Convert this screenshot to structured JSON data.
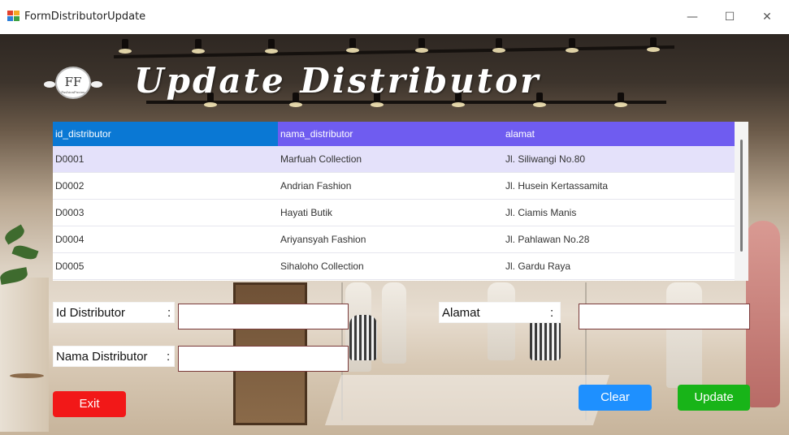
{
  "window": {
    "title": "FormDistributorUpdate",
    "minimize_glyph": "—",
    "maximize_glyph": "☐",
    "close_glyph": "✕"
  },
  "logo": {
    "monogram": "FF",
    "name": "FashionFusion"
  },
  "heading": "Update Distributor",
  "grid": {
    "columns": [
      "id_distributor",
      "nama_distributor",
      "alamat"
    ],
    "rows": [
      [
        "D0001",
        "Marfuah Collection",
        "Jl. Siliwangi No.80"
      ],
      [
        "D0002",
        "Andrian Fashion",
        "Jl. Husein Kertassamita"
      ],
      [
        "D0003",
        "Hayati Butik",
        "Jl. Ciamis Manis"
      ],
      [
        "D0004",
        "Ariyansyah Fashion",
        "Jl. Pahlawan No.28"
      ],
      [
        "D0005",
        "Sihaloho Collection",
        "Jl. Gardu Raya"
      ]
    ],
    "selected_row": 0
  },
  "form": {
    "id_label": "Id Distributor",
    "nama_label": "Nama Distributor",
    "alamat_label": "Alamat",
    "colon": ":",
    "id_value": "",
    "nama_value": "",
    "alamat_value": ""
  },
  "buttons": {
    "exit": "Exit",
    "clear": "Clear",
    "update": "Update"
  },
  "colors": {
    "header_primary": "#0a78d4",
    "header_secondary": "#6f5cf0",
    "exit": "#f21818",
    "clear": "#1e90ff",
    "update": "#18b418"
  }
}
